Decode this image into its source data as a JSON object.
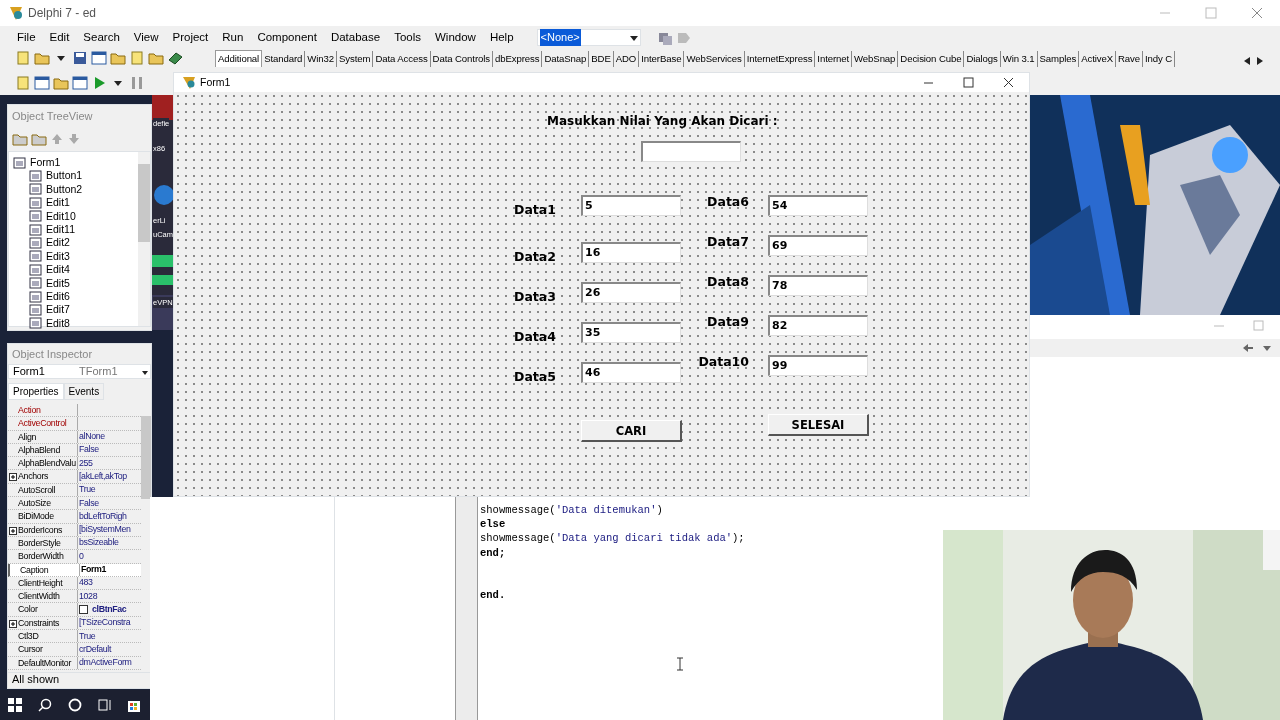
{
  "ide": {
    "title": "Delphi 7 - ed",
    "menu": [
      "File",
      "Edit",
      "Search",
      "View",
      "Project",
      "Run",
      "Component",
      "Database",
      "Tools",
      "Window",
      "Help"
    ],
    "config_combo": "<None>",
    "palette_tabs": [
      {
        "label": "Additional",
        "selected": true
      },
      {
        "label": "Standard",
        "selected": false
      },
      {
        "label": "Win32",
        "selected": false
      },
      {
        "label": "System",
        "selected": false
      },
      {
        "label": "Data Access",
        "selected": false
      },
      {
        "label": "Data Controls",
        "selected": false
      },
      {
        "label": "dbExpress",
        "selected": false
      },
      {
        "label": "DataSnap",
        "selected": false
      },
      {
        "label": "BDE",
        "selected": false
      },
      {
        "label": "ADO",
        "selected": false
      },
      {
        "label": "InterBase",
        "selected": false
      },
      {
        "label": "WebServices",
        "selected": false
      },
      {
        "label": "InternetExpress",
        "selected": false
      },
      {
        "label": "Internet",
        "selected": false
      },
      {
        "label": "WebSnap",
        "selected": false
      },
      {
        "label": "Decision Cube",
        "selected": false
      },
      {
        "label": "Dialogs",
        "selected": false
      },
      {
        "label": "Win 3.1",
        "selected": false
      },
      {
        "label": "Samples",
        "selected": false
      },
      {
        "label": "ActiveX",
        "selected": false
      },
      {
        "label": "Rave",
        "selected": false
      },
      {
        "label": "Indy C",
        "selected": false
      }
    ]
  },
  "desktop_labels": [
    "defie",
    "x86",
    "erLi",
    "uCam",
    "eVPN"
  ],
  "tree_view": {
    "title": "Object TreeView",
    "root": {
      "label": "Form1",
      "children": [
        {
          "label": "Button1"
        },
        {
          "label": "Button2"
        },
        {
          "label": "Edit1"
        },
        {
          "label": "Edit10"
        },
        {
          "label": "Edit11"
        },
        {
          "label": "Edit2"
        },
        {
          "label": "Edit3"
        },
        {
          "label": "Edit4"
        },
        {
          "label": "Edit5"
        },
        {
          "label": "Edit6"
        },
        {
          "label": "Edit7"
        },
        {
          "label": "Edit8"
        }
      ]
    }
  },
  "object_inspector": {
    "title": "Object Inspector",
    "component": "Form1",
    "component_type": "TForm1",
    "tabs": [
      {
        "label": "Properties",
        "selected": true
      },
      {
        "label": "Events",
        "selected": false
      }
    ],
    "properties": [
      {
        "name": "Action",
        "kind": "link",
        "selected": false
      },
      {
        "name": "ActiveControl",
        "kind": "link",
        "selected": false
      },
      {
        "name": "Align",
        "value": "alNone",
        "kind": "plain",
        "selected": false
      },
      {
        "name": "AlphaBlend",
        "value": "False",
        "kind": "plain",
        "selected": false
      },
      {
        "name": "AlphaBlendValu",
        "value": "255",
        "kind": "plain",
        "selected": false
      },
      {
        "name": "Anchors",
        "value": "[akLeft,akTop",
        "kind": "set",
        "expanded": false,
        "selected": false
      },
      {
        "name": "AutoScroll",
        "value": "True",
        "kind": "plain",
        "selected": false
      },
      {
        "name": "AutoSize",
        "value": "False",
        "kind": "plain",
        "selected": false
      },
      {
        "name": "BiDiMode",
        "value": "bdLeftToRigh",
        "kind": "plain",
        "selected": false
      },
      {
        "name": "BorderIcons",
        "value": "[biSystemMen",
        "kind": "set",
        "expanded": false,
        "selected": false
      },
      {
        "name": "BorderStyle",
        "value": "bsSizeable",
        "kind": "plain",
        "selected": false
      },
      {
        "name": "BorderWidth",
        "value": "0",
        "kind": "plain",
        "selected": false
      },
      {
        "name": "Caption",
        "value": "Form1",
        "kind": "plain",
        "selected": true
      },
      {
        "name": "ClientHeight",
        "value": "483",
        "kind": "plain",
        "selected": false
      },
      {
        "name": "ClientWidth",
        "value": "1028",
        "kind": "plain",
        "selected": false
      },
      {
        "name": "Color",
        "value": "clBtnFac",
        "kind": "color",
        "selected": false
      },
      {
        "name": "Constraints",
        "value": "[TSizeConstra",
        "kind": "set",
        "expanded": false,
        "selected": false
      },
      {
        "name": "Ctl3D",
        "value": "True",
        "kind": "plain",
        "selected": false
      },
      {
        "name": "Cursor",
        "value": "crDefault",
        "kind": "plain",
        "selected": false
      },
      {
        "name": "DefaultMonitor",
        "value": "dmActiveForm",
        "kind": "plain",
        "selected": false
      }
    ],
    "status": "All shown"
  },
  "form": {
    "title": "Form1",
    "prompt": "Masukkan Nilai Yang Akan Dicari :",
    "fields": [
      {
        "label": "Data1",
        "value": "5"
      },
      {
        "label": "Data2",
        "value": "16"
      },
      {
        "label": "Data3",
        "value": "26"
      },
      {
        "label": "Data4",
        "value": "35"
      },
      {
        "label": "Data5",
        "value": "46"
      },
      {
        "label": "Data6",
        "value": "54"
      },
      {
        "label": "Data7",
        "value": "69"
      },
      {
        "label": "Data8",
        "value": "78"
      },
      {
        "label": "Data9",
        "value": "82"
      },
      {
        "label": "Data10",
        "value": "99"
      }
    ],
    "buttons": [
      "CARI",
      "SELESAI"
    ]
  },
  "code_lines": [
    {
      "kind": "code",
      "parts": [
        {
          "text": "showmessage(",
          "kind": "plain"
        },
        {
          "text": "'Data ditemukan'",
          "kind": "string"
        },
        {
          "text": ")",
          "kind": "plain"
        }
      ]
    },
    {
      "kind": "code",
      "parts": [
        {
          "text": "else",
          "kind": "keyword"
        }
      ]
    },
    {
      "kind": "code",
      "parts": [
        {
          "text": "showmessage(",
          "kind": "plain"
        },
        {
          "text": "'Data yang dicari tidak ada'",
          "kind": "string"
        },
        {
          "text": ");",
          "kind": "plain"
        }
      ]
    },
    {
      "kind": "code",
      "parts": [
        {
          "text": "end;",
          "kind": "keyword"
        }
      ]
    },
    {
      "kind": "blank"
    },
    {
      "kind": "blank"
    },
    {
      "kind": "code",
      "parts": [
        {
          "text": "end.",
          "kind": "keyword"
        }
      ]
    }
  ]
}
